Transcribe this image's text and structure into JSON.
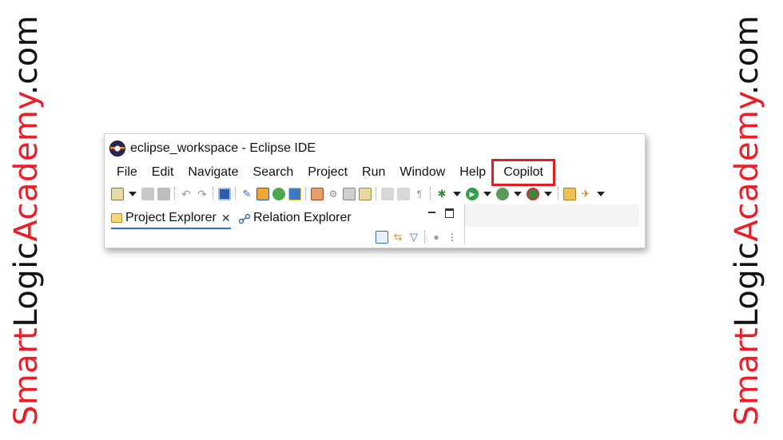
{
  "watermark": {
    "part1": "Smart",
    "part2": "Logic",
    "part3": "Academy",
    "part4": ".com"
  },
  "window": {
    "title": "eclipse_workspace - Eclipse IDE"
  },
  "menu": {
    "items": [
      "File",
      "Edit",
      "Navigate",
      "Search",
      "Project",
      "Run",
      "Window",
      "Help",
      "Copilot"
    ]
  },
  "toolbar_icons": [
    "new-wizard-icon",
    "save-icon",
    "save-all-icon",
    "undo-icon",
    "redo-icon",
    "terminal-icon",
    "pin-icon",
    "open-type-icon",
    "open-task-icon",
    "new-java-icon",
    "new-package-icon",
    "new-class-icon",
    "print-icon",
    "properties-icon",
    "toggle-whitespace-icon",
    "debug-icon",
    "run-icon",
    "coverage-icon",
    "external-tools-icon",
    "open-folder-icon",
    "launch-icon"
  ],
  "views": {
    "tabs": [
      {
        "label": "Project Explorer",
        "active": true,
        "closable": true
      },
      {
        "label": "Relation Explorer",
        "active": false,
        "closable": false
      }
    ],
    "close_glyph": "✕"
  },
  "colors": {
    "highlight": "#e21c1c",
    "brand_red": "#ee1c25",
    "active_tab": "#2a6fd6"
  }
}
